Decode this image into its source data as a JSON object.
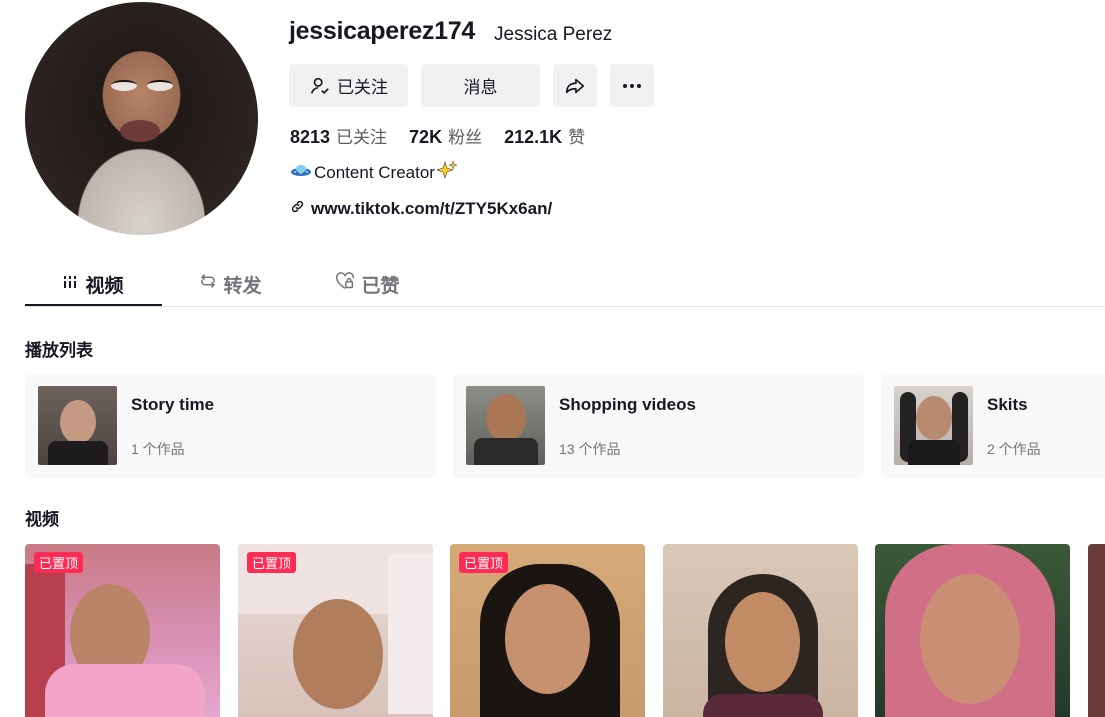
{
  "profile": {
    "username": "jessicaperez174",
    "nickname": "Jessica Perez",
    "bio": "Content Creator",
    "link": "www.tiktok.com/t/ZTY5Kx6an/"
  },
  "buttons": {
    "following": "已关注",
    "message": "消息"
  },
  "stats": [
    {
      "value": "8213",
      "label": "已关注"
    },
    {
      "value": "72K",
      "label": "粉丝"
    },
    {
      "value": "212.1K",
      "label": "赞"
    }
  ],
  "tabs": [
    {
      "label": "视频",
      "active": true
    },
    {
      "label": "转发",
      "active": false
    },
    {
      "label": "已赞",
      "active": false
    }
  ],
  "sections": {
    "playlists": "播放列表",
    "videos": "视频"
  },
  "playlists": [
    {
      "title": "Story time",
      "count": "1 个作品"
    },
    {
      "title": "Shopping videos",
      "count": "13 个作品"
    },
    {
      "title": "Skits",
      "count": "2 个作品"
    }
  ],
  "videos": [
    {
      "pinned_label": "已置顶"
    },
    {
      "pinned_label": "已置顶"
    },
    {
      "pinned_label": "已置顶"
    },
    {
      "pinned_label": ""
    },
    {
      "pinned_label": ""
    }
  ],
  "colors": {
    "accent": "#fe2c55",
    "text": "#161823",
    "muted": "#73747b",
    "button_bg": "#f1f1f2"
  }
}
